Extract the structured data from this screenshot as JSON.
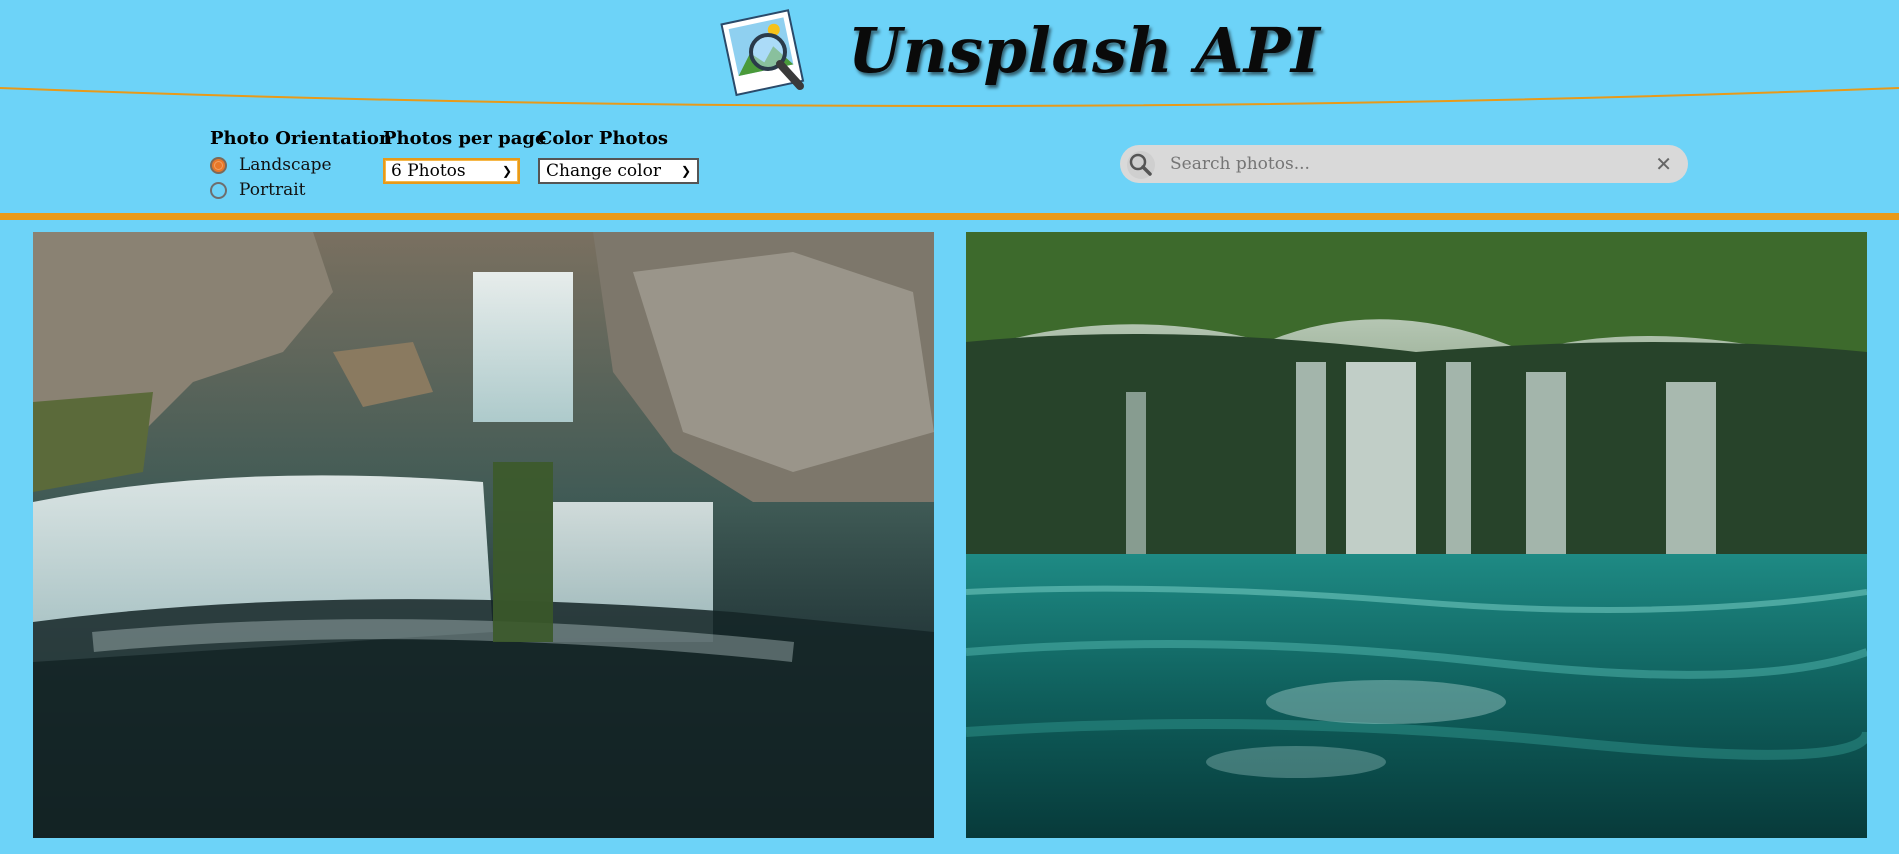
{
  "header": {
    "title": "Unsplash API"
  },
  "controls": {
    "orientation": {
      "label": "Photo Orientation",
      "options": [
        "Landscape",
        "Portrait"
      ],
      "selected": "Landscape"
    },
    "per_page": {
      "label": "Photos per page",
      "value": "6 Photos"
    },
    "color": {
      "label": "Color Photos",
      "value": "Change color"
    }
  },
  "search": {
    "placeholder": "Search photos..."
  },
  "photos": [
    {
      "subject": "cascading waterfall over rocks"
    },
    {
      "subject": "waterfalls into turquoise lake"
    }
  ],
  "colors": {
    "background": "#6dd3f8",
    "accent": "#e89a1a"
  }
}
